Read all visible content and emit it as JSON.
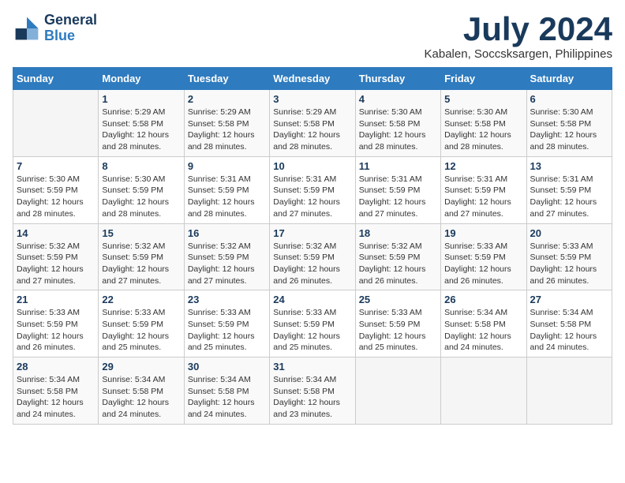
{
  "header": {
    "logo_line1": "General",
    "logo_line2": "Blue",
    "month_year": "July 2024",
    "location": "Kabalen, Soccsksargen, Philippines"
  },
  "weekdays": [
    "Sunday",
    "Monday",
    "Tuesday",
    "Wednesday",
    "Thursday",
    "Friday",
    "Saturday"
  ],
  "weeks": [
    [
      {
        "day": "",
        "info": ""
      },
      {
        "day": "1",
        "info": "Sunrise: 5:29 AM\nSunset: 5:58 PM\nDaylight: 12 hours\nand 28 minutes."
      },
      {
        "day": "2",
        "info": "Sunrise: 5:29 AM\nSunset: 5:58 PM\nDaylight: 12 hours\nand 28 minutes."
      },
      {
        "day": "3",
        "info": "Sunrise: 5:29 AM\nSunset: 5:58 PM\nDaylight: 12 hours\nand 28 minutes."
      },
      {
        "day": "4",
        "info": "Sunrise: 5:30 AM\nSunset: 5:58 PM\nDaylight: 12 hours\nand 28 minutes."
      },
      {
        "day": "5",
        "info": "Sunrise: 5:30 AM\nSunset: 5:58 PM\nDaylight: 12 hours\nand 28 minutes."
      },
      {
        "day": "6",
        "info": "Sunrise: 5:30 AM\nSunset: 5:58 PM\nDaylight: 12 hours\nand 28 minutes."
      }
    ],
    [
      {
        "day": "7",
        "info": "Sunrise: 5:30 AM\nSunset: 5:59 PM\nDaylight: 12 hours\nand 28 minutes."
      },
      {
        "day": "8",
        "info": "Sunrise: 5:30 AM\nSunset: 5:59 PM\nDaylight: 12 hours\nand 28 minutes."
      },
      {
        "day": "9",
        "info": "Sunrise: 5:31 AM\nSunset: 5:59 PM\nDaylight: 12 hours\nand 28 minutes."
      },
      {
        "day": "10",
        "info": "Sunrise: 5:31 AM\nSunset: 5:59 PM\nDaylight: 12 hours\nand 27 minutes."
      },
      {
        "day": "11",
        "info": "Sunrise: 5:31 AM\nSunset: 5:59 PM\nDaylight: 12 hours\nand 27 minutes."
      },
      {
        "day": "12",
        "info": "Sunrise: 5:31 AM\nSunset: 5:59 PM\nDaylight: 12 hours\nand 27 minutes."
      },
      {
        "day": "13",
        "info": "Sunrise: 5:31 AM\nSunset: 5:59 PM\nDaylight: 12 hours\nand 27 minutes."
      }
    ],
    [
      {
        "day": "14",
        "info": "Sunrise: 5:32 AM\nSunset: 5:59 PM\nDaylight: 12 hours\nand 27 minutes."
      },
      {
        "day": "15",
        "info": "Sunrise: 5:32 AM\nSunset: 5:59 PM\nDaylight: 12 hours\nand 27 minutes."
      },
      {
        "day": "16",
        "info": "Sunrise: 5:32 AM\nSunset: 5:59 PM\nDaylight: 12 hours\nand 27 minutes."
      },
      {
        "day": "17",
        "info": "Sunrise: 5:32 AM\nSunset: 5:59 PM\nDaylight: 12 hours\nand 26 minutes."
      },
      {
        "day": "18",
        "info": "Sunrise: 5:32 AM\nSunset: 5:59 PM\nDaylight: 12 hours\nand 26 minutes."
      },
      {
        "day": "19",
        "info": "Sunrise: 5:33 AM\nSunset: 5:59 PM\nDaylight: 12 hours\nand 26 minutes."
      },
      {
        "day": "20",
        "info": "Sunrise: 5:33 AM\nSunset: 5:59 PM\nDaylight: 12 hours\nand 26 minutes."
      }
    ],
    [
      {
        "day": "21",
        "info": "Sunrise: 5:33 AM\nSunset: 5:59 PM\nDaylight: 12 hours\nand 26 minutes."
      },
      {
        "day": "22",
        "info": "Sunrise: 5:33 AM\nSunset: 5:59 PM\nDaylight: 12 hours\nand 25 minutes."
      },
      {
        "day": "23",
        "info": "Sunrise: 5:33 AM\nSunset: 5:59 PM\nDaylight: 12 hours\nand 25 minutes."
      },
      {
        "day": "24",
        "info": "Sunrise: 5:33 AM\nSunset: 5:59 PM\nDaylight: 12 hours\nand 25 minutes."
      },
      {
        "day": "25",
        "info": "Sunrise: 5:33 AM\nSunset: 5:59 PM\nDaylight: 12 hours\nand 25 minutes."
      },
      {
        "day": "26",
        "info": "Sunrise: 5:34 AM\nSunset: 5:58 PM\nDaylight: 12 hours\nand 24 minutes."
      },
      {
        "day": "27",
        "info": "Sunrise: 5:34 AM\nSunset: 5:58 PM\nDaylight: 12 hours\nand 24 minutes."
      }
    ],
    [
      {
        "day": "28",
        "info": "Sunrise: 5:34 AM\nSunset: 5:58 PM\nDaylight: 12 hours\nand 24 minutes."
      },
      {
        "day": "29",
        "info": "Sunrise: 5:34 AM\nSunset: 5:58 PM\nDaylight: 12 hours\nand 24 minutes."
      },
      {
        "day": "30",
        "info": "Sunrise: 5:34 AM\nSunset: 5:58 PM\nDaylight: 12 hours\nand 24 minutes."
      },
      {
        "day": "31",
        "info": "Sunrise: 5:34 AM\nSunset: 5:58 PM\nDaylight: 12 hours\nand 23 minutes."
      },
      {
        "day": "",
        "info": ""
      },
      {
        "day": "",
        "info": ""
      },
      {
        "day": "",
        "info": ""
      }
    ]
  ]
}
